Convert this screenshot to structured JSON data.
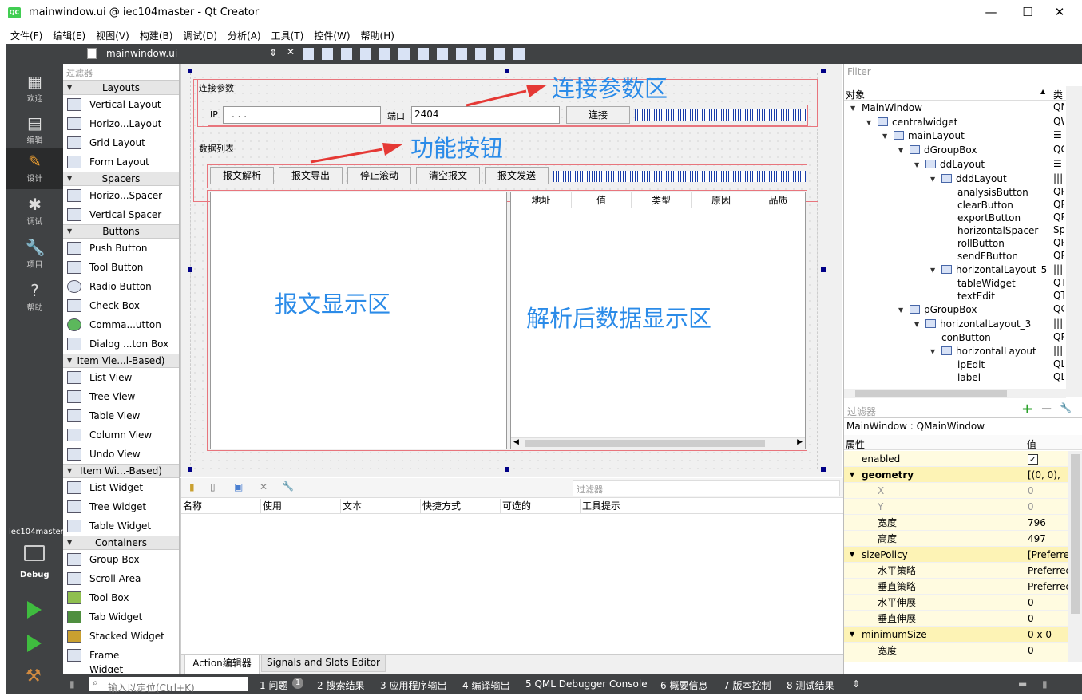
{
  "window": {
    "title": "mainwindow.ui @ iec104master - Qt Creator",
    "controls": [
      "—",
      "☐",
      "✕"
    ]
  },
  "menu": [
    "文件(F)",
    "编辑(E)",
    "视图(V)",
    "构建(B)",
    "调试(D)",
    "分析(A)",
    "工具(T)",
    "控件(W)",
    "帮助(H)"
  ],
  "modes": [
    {
      "label": "欢迎",
      "icon": "grid-icon"
    },
    {
      "label": "编辑",
      "icon": "document-icon"
    },
    {
      "label": "设计",
      "icon": "pencil-icon"
    },
    {
      "label": "调试",
      "icon": "bug-icon"
    },
    {
      "label": "项目",
      "icon": "wrench-icon"
    },
    {
      "label": "帮助",
      "icon": "help-icon"
    }
  ],
  "kit": {
    "project": "iec104master",
    "config": "Debug"
  },
  "editor": {
    "file_tab": "mainwindow.ui"
  },
  "widgetbox": {
    "filter_placeholder": "过滤器",
    "categories": [
      {
        "name": "Layouts",
        "items": [
          "Vertical Layout",
          "Horizo...Layout",
          "Grid Layout",
          "Form Layout"
        ]
      },
      {
        "name": "Spacers",
        "items": [
          "Horizo...Spacer",
          "Vertical Spacer"
        ]
      },
      {
        "name": "Buttons",
        "items": [
          "Push Button",
          "Tool Button",
          "Radio Button",
          "Check Box",
          "Comma...utton",
          "Dialog ...ton Box"
        ]
      },
      {
        "name": "Item Vie...l-Based)",
        "items": [
          "List View",
          "Tree View",
          "Table View",
          "Column View",
          "Undo View"
        ]
      },
      {
        "name": "Item Wi...-Based)",
        "items": [
          "List Widget",
          "Tree Widget",
          "Table Widget"
        ]
      },
      {
        "name": "Containers",
        "items": [
          "Group Box",
          "Scroll Area",
          "Tool Box",
          "Tab Widget",
          "Stacked Widget",
          "Frame",
          "Widget"
        ]
      }
    ]
  },
  "form": {
    "conn_group_title": "连接参数",
    "ip_label": "IP",
    "ip_value": ". . .",
    "port_label": "端口",
    "port_value": "2404",
    "connect_button": "连接",
    "data_group_title": "数据列表",
    "buttons": [
      "报文解析",
      "报文导出",
      "停止滚动",
      "清空报文",
      "报文发送"
    ],
    "table_headers": [
      "地址",
      "值",
      "类型",
      "原因",
      "品质"
    ],
    "annotation_conn": "连接参数区",
    "annotation_buttons": "功能按钮",
    "annotation_msg": "报文显示区",
    "annotation_parsed": "解析后数据显示区"
  },
  "action_editor": {
    "filter_placeholder": "过滤器",
    "columns": [
      "名称",
      "使用",
      "文本",
      "快捷方式",
      "可选的",
      "工具提示"
    ],
    "tabs": [
      "Action编辑器",
      "Signals and Slots Editor"
    ]
  },
  "object_inspector": {
    "filter_placeholder": "Filter",
    "col_object": "对象",
    "col_class": "类",
    "rows": [
      {
        "name": "MainWindow",
        "cls": "QM"
      },
      {
        "name": "centralwidget",
        "cls": "QW"
      },
      {
        "name": "mainLayout",
        "cls": "☰"
      },
      {
        "name": "dGroupBox",
        "cls": "QG"
      },
      {
        "name": "ddLayout",
        "cls": "☰"
      },
      {
        "name": "dddLayout",
        "cls": "|||"
      },
      {
        "name": "analysisButton",
        "cls": "QP"
      },
      {
        "name": "clearButton",
        "cls": "QP"
      },
      {
        "name": "exportButton",
        "cls": "QP"
      },
      {
        "name": "horizontalSpacer",
        "cls": "Sp"
      },
      {
        "name": "rollButton",
        "cls": "QP"
      },
      {
        "name": "sendFButton",
        "cls": "QP"
      },
      {
        "name": "horizontalLayout_5",
        "cls": "|||"
      },
      {
        "name": "tableWidget",
        "cls": "QT"
      },
      {
        "name": "textEdit",
        "cls": "QT"
      },
      {
        "name": "pGroupBox",
        "cls": "QG"
      },
      {
        "name": "horizontalLayout_3",
        "cls": "|||"
      },
      {
        "name": "conButton",
        "cls": "QP"
      },
      {
        "name": "horizontalLayout",
        "cls": "|||"
      },
      {
        "name": "ipEdit",
        "cls": "QL"
      },
      {
        "name": "label",
        "cls": "QL"
      }
    ]
  },
  "property_editor": {
    "filter_placeholder": "过滤器",
    "object_title": "MainWindow : QMainWindow",
    "col_property": "属性",
    "col_value": "值",
    "rows": [
      {
        "k": "enabled",
        "v": "✓"
      },
      {
        "k": "geometry",
        "v": "[(0, 0), 79"
      },
      {
        "k": "X",
        "v": "0"
      },
      {
        "k": "Y",
        "v": "0"
      },
      {
        "k": "宽度",
        "v": "796"
      },
      {
        "k": "高度",
        "v": "497"
      },
      {
        "k": "sizePolicy",
        "v": "[Preferre"
      },
      {
        "k": "水平策略",
        "v": "Preferred"
      },
      {
        "k": "垂直策略",
        "v": "Preferred"
      },
      {
        "k": "水平伸展",
        "v": "0"
      },
      {
        "k": "垂直伸展",
        "v": "0"
      },
      {
        "k": "minimumSize",
        "v": "0 x 0"
      },
      {
        "k": "宽度",
        "v": "0"
      }
    ]
  },
  "statusbar": {
    "locator_placeholder": "输入以定位(Ctrl+K)",
    "panes": [
      "1 问题",
      "2 搜索结果",
      "3 应用程序输出",
      "4 编译输出",
      "5 QML Debugger Console",
      "6 概要信息",
      "7 版本控制",
      "8 测试结果"
    ],
    "issues_badge": "1"
  },
  "colors": {
    "accent_annotation": "#2b8be8",
    "arrow": "#e53935",
    "layout_outline": "#e8757d",
    "sidebar": "#404244"
  }
}
